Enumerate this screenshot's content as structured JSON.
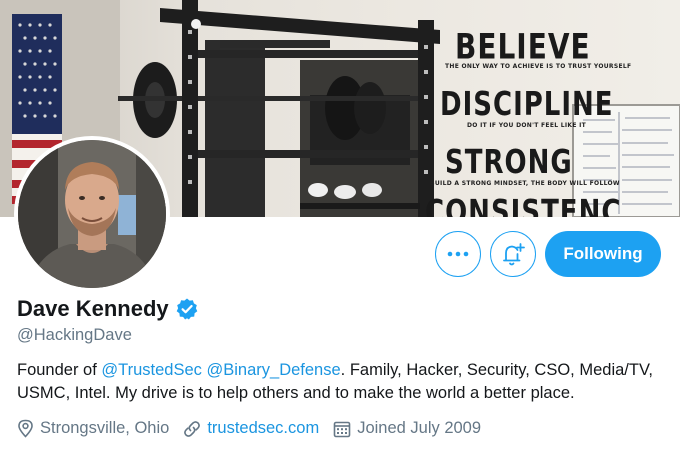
{
  "banner": {
    "wall_words": [
      "BELIEVE",
      "DISCIPLINE",
      "STRONG",
      "CONSISTENC"
    ],
    "wall_subtexts": [
      "THE ONLY WAY TO ACHIEVE IS TO TRUST YOURSELF",
      "DO IT IF YOU DON'T FEEL LIKE IT",
      "BUILD A STRONG MINDSET, THE BODY WILL FOLLOW"
    ]
  },
  "actions": {
    "more_icon": "more-horizontal-icon",
    "notify_icon": "bell-plus-icon",
    "follow_label": "Following"
  },
  "profile": {
    "name": "Dave Kennedy",
    "verified_icon": "verified-badge-icon",
    "handle": "@HackingDave",
    "bio": {
      "prefix": "Founder of ",
      "mention1": "@TrustedSec",
      "space": " ",
      "mention2": "@Binary_Defense",
      "suffix": ". Family, Hacker, Security, CSO, Media/TV, USMC, Intel. My drive is to help others and to make the world a better place."
    },
    "location": "Strongsville, Ohio",
    "website": "trustedsec.com",
    "joined": "Joined July 2009"
  },
  "colors": {
    "accent": "#1da1f2",
    "link": "#1b95e0",
    "secondary_text": "#657786",
    "primary_text": "#14171a"
  }
}
